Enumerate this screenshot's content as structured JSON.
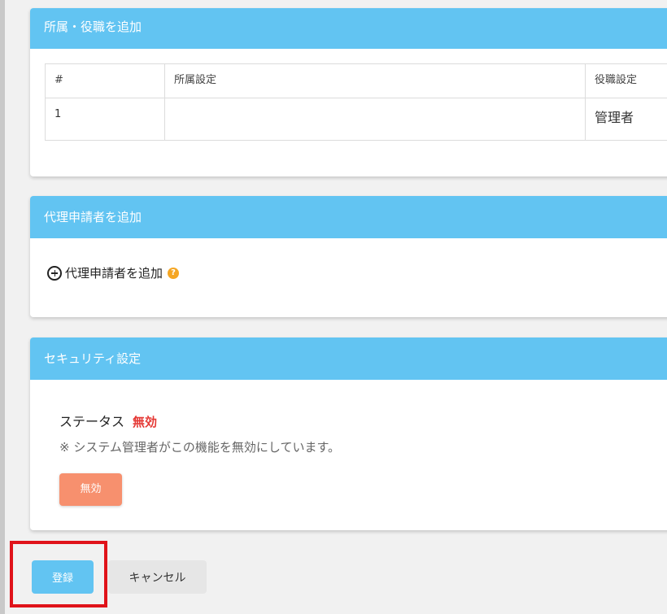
{
  "affiliation_card": {
    "title": "所属・役職を追加",
    "columns": [
      "#",
      "所属設定",
      "役職設定"
    ],
    "rows": [
      {
        "num": "1",
        "department": "",
        "role": "管理者"
      }
    ]
  },
  "proxy_card": {
    "title": "代理申請者を追加",
    "add_label": "代理申請者を追加",
    "help_icon": "question-circle-icon",
    "help_glyph": "?"
  },
  "security_card": {
    "title": "セキュリティ設定",
    "status_label": "ステータス",
    "status_value": "無効",
    "status_color": "#e53935",
    "note": "※ システム管理者がこの機能を無効にしています。",
    "disabled_button_label": "無効"
  },
  "actions": {
    "register_label": "登録",
    "cancel_label": "キャンセル"
  },
  "colors": {
    "header": "#62c4f2",
    "primary_button": "#62c4f2",
    "disabled_button": "#f7906e",
    "highlight": "#e0131a"
  }
}
